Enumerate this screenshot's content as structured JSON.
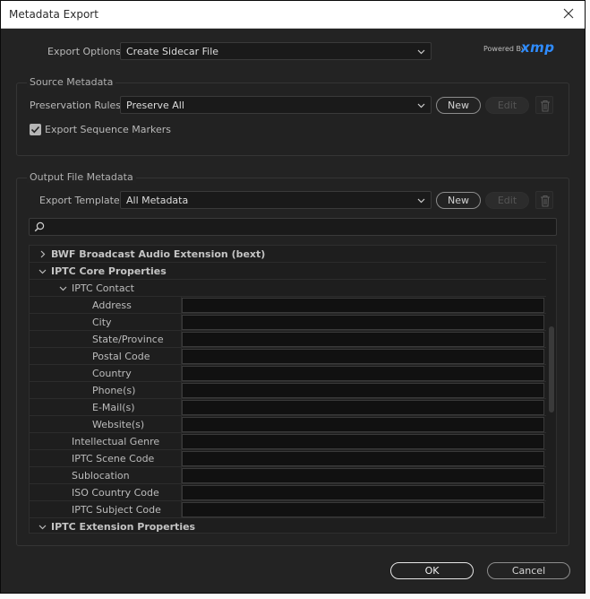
{
  "dialog": {
    "title": "Metadata Export",
    "ok_label": "OK",
    "cancel_label": "Cancel"
  },
  "export_options": {
    "label": "Export Options:",
    "value": "Create Sidecar File",
    "powered_by": "Powered By",
    "brand": "xmp"
  },
  "source_metadata": {
    "title": "Source Metadata",
    "preservation_label": "Preservation Rules:",
    "preservation_value": "Preserve All",
    "new_label": "New",
    "edit_label": "Edit",
    "export_markers_label": "Export Sequence Markers",
    "export_markers_checked": true
  },
  "output_metadata": {
    "title": "Output File Metadata",
    "template_label": "Export Template:",
    "template_value": "All Metadata",
    "new_label": "New",
    "edit_label": "Edit",
    "search_placeholder": ""
  },
  "tree": {
    "rows": [
      {
        "label": "BWF Broadcast Audio Extension (bext)",
        "level": 0,
        "twisty": "collapsed",
        "bold": true,
        "field": false
      },
      {
        "label": "IPTC Core Properties",
        "level": 0,
        "twisty": "expanded",
        "bold": true,
        "field": false
      },
      {
        "label": "IPTC Contact",
        "level": 1,
        "twisty": "expanded",
        "bold": false,
        "field": false
      },
      {
        "label": "Address",
        "level": 2,
        "twisty": "none",
        "bold": false,
        "field": true
      },
      {
        "label": "City",
        "level": 2,
        "twisty": "none",
        "bold": false,
        "field": true
      },
      {
        "label": "State/Province",
        "level": 2,
        "twisty": "none",
        "bold": false,
        "field": true
      },
      {
        "label": "Postal Code",
        "level": 2,
        "twisty": "none",
        "bold": false,
        "field": true
      },
      {
        "label": "Country",
        "level": 2,
        "twisty": "none",
        "bold": false,
        "field": true
      },
      {
        "label": "Phone(s)",
        "level": 2,
        "twisty": "none",
        "bold": false,
        "field": true
      },
      {
        "label": "E-Mail(s)",
        "level": 2,
        "twisty": "none",
        "bold": false,
        "field": true
      },
      {
        "label": "Website(s)",
        "level": 2,
        "twisty": "none",
        "bold": false,
        "field": true
      },
      {
        "label": "Intellectual Genre",
        "level": 1,
        "twisty": "none",
        "bold": false,
        "field": true
      },
      {
        "label": "IPTC Scene Code",
        "level": 1,
        "twisty": "none",
        "bold": false,
        "field": true
      },
      {
        "label": "Sublocation",
        "level": 1,
        "twisty": "none",
        "bold": false,
        "field": true
      },
      {
        "label": "ISO Country Code",
        "level": 1,
        "twisty": "none",
        "bold": false,
        "field": true
      },
      {
        "label": "IPTC Subject Code",
        "level": 1,
        "twisty": "none",
        "bold": false,
        "field": true
      },
      {
        "label": "IPTC Extension Properties",
        "level": 0,
        "twisty": "expanded",
        "bold": true,
        "field": false
      }
    ]
  },
  "colors": {
    "dialog_bg": "#232323",
    "accent_xmp": "#2f8cff"
  }
}
